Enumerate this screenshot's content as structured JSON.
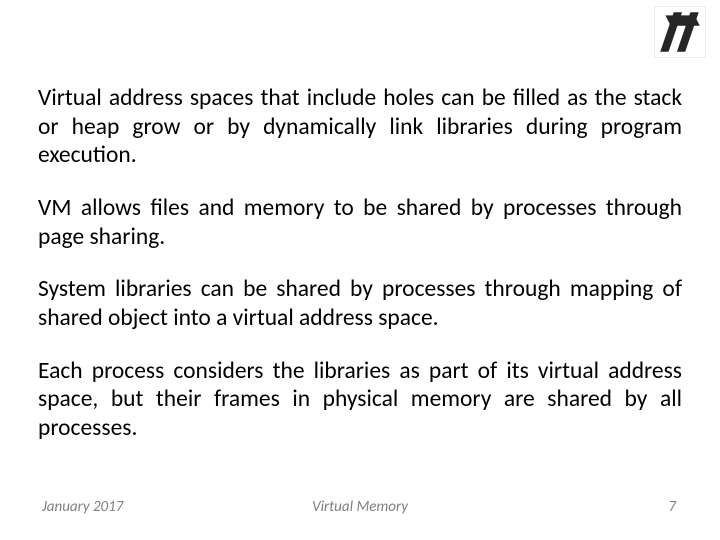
{
  "paragraphs": {
    "p1": "Virtual address spaces that include holes can be filled as the stack or heap grow or by dynamically link libraries during program execution.",
    "p2": "VM allows files and memory to be shared by processes through page sharing.",
    "p3": "System libraries can be shared by processes through mapping of shared object into a virtual address space.",
    "p4": "Each process considers the libraries as part of its virtual address space, but their frames in physical memory are shared by all processes."
  },
  "footer": {
    "date": "January 2017",
    "title": "Virtual Memory",
    "page": "7"
  }
}
